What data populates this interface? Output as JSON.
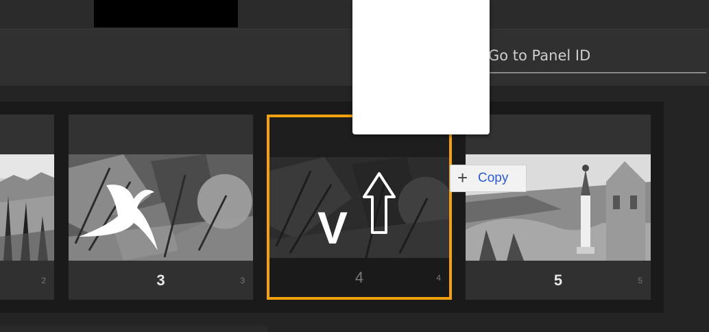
{
  "toolbar": {
    "goto_label": "Go to Panel ID"
  },
  "panels": [
    {
      "number": "",
      "sub_number": "2"
    },
    {
      "number": "3",
      "sub_number": "3"
    },
    {
      "number": "4",
      "sub_number": "4"
    },
    {
      "number": "5",
      "sub_number": "5"
    }
  ],
  "drop_overlay": {
    "letter": "V"
  },
  "copy_tooltip": {
    "plus": "+",
    "label": "Copy"
  },
  "colors": {
    "selection_border": "#f5a10f",
    "copy_text": "#2a5bd7",
    "background": "#242424"
  }
}
